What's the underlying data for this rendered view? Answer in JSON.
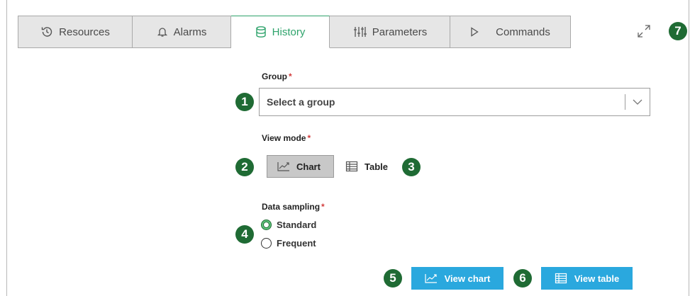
{
  "tabs": [
    {
      "label": "Resources",
      "icon": "history-clock-icon"
    },
    {
      "label": "Alarms",
      "icon": "bell-icon"
    },
    {
      "label": "History",
      "icon": "database-icon",
      "active": true
    },
    {
      "label": "Parameters",
      "icon": "sliders-icon"
    },
    {
      "label": "Commands",
      "icon": "play-icon"
    }
  ],
  "form": {
    "group_label": "Group",
    "group_placeholder": "Select a group",
    "view_mode_label": "View mode",
    "view_modes": [
      "Chart",
      "Table"
    ],
    "view_mode_selected": "Chart",
    "sampling_label": "Data sampling",
    "sampling_options": [
      "Standard",
      "Frequent"
    ],
    "sampling_selected": "Standard",
    "required_mark": "*"
  },
  "actions": {
    "view_chart": "View chart",
    "view_table": "View table"
  },
  "markers": [
    "1",
    "2",
    "3",
    "4",
    "5",
    "6",
    "7"
  ],
  "colors": {
    "accent_green": "#2ea36b",
    "marker_green": "#1f6b34",
    "action_blue": "#2aa8de",
    "required_red": "#d23c3c"
  }
}
